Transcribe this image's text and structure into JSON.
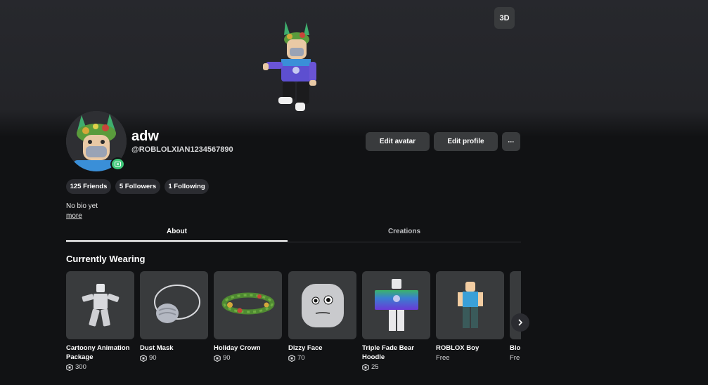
{
  "stage": {
    "view_toggle": "3D"
  },
  "profile": {
    "display_name": "adw",
    "username": "@ROBLOLXIAN1234567890",
    "edit_avatar": "Edit avatar",
    "edit_profile": "Edit profile",
    "more_options": "···",
    "bio": "No bio yet",
    "bio_more": "more"
  },
  "stats": {
    "friends": "125 Friends",
    "followers": "5 Followers",
    "following": "1 Following"
  },
  "tabs": [
    {
      "label": "About",
      "active": true
    },
    {
      "label": "Creations",
      "active": false
    }
  ],
  "wearing": {
    "title": "Currently Wearing",
    "items": [
      {
        "name": "Cartoony Animation Package",
        "price": "300",
        "robux": true,
        "icon": "animation-figure"
      },
      {
        "name": "Dust Mask",
        "price": "90",
        "robux": true,
        "icon": "dust-mask"
      },
      {
        "name": "Holiday Crown",
        "price": "90",
        "robux": true,
        "icon": "holiday-wreath"
      },
      {
        "name": "Dizzy Face",
        "price": "70",
        "robux": true,
        "icon": "face-head"
      },
      {
        "name": "Triple Fade Bear Hoodle",
        "price": "25",
        "robux": true,
        "icon": "hoodie-shirt"
      },
      {
        "name": "ROBLOX Boy",
        "price": "Free",
        "robux": false,
        "icon": "roblox-boy-figure"
      },
      {
        "name": "Blo",
        "price": "Fre",
        "robux": false,
        "icon": "partial-item"
      }
    ]
  },
  "colors": {
    "background": "#111214",
    "card": "#393b3d",
    "pill": "#2b2c31",
    "presence": "#3fc679",
    "text_secondary": "#d6d7d9"
  }
}
